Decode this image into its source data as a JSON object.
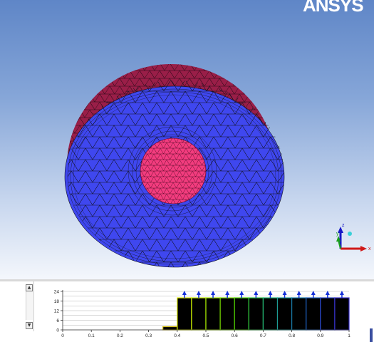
{
  "viewport": {
    "logo_text": "ANSYS",
    "triad": {
      "x_label": "x",
      "y_label": "y",
      "z_label": "z"
    },
    "colors": {
      "body_mesh": "#3f47ef",
      "outer_shell": "#9a1e48",
      "inner_sphere": "#f23c7e",
      "mesh_lines": "#111122",
      "x_axis": "#d01818",
      "y_axis": "#1aa01a",
      "z_axis": "#1818c8"
    }
  },
  "histogram": {
    "chart_data": {
      "type": "bar",
      "bin_edges": [
        0.35,
        0.4,
        0.45,
        0.5,
        0.55,
        0.6,
        0.65,
        0.7,
        0.75,
        0.8,
        0.85,
        0.9,
        0.95,
        1.0
      ],
      "values": [
        2,
        20,
        20,
        20,
        20,
        20,
        20,
        20,
        20,
        20,
        20,
        20,
        20
      ],
      "bar_colors": [
        "#c8b000",
        "#e2f000",
        "#c9f000",
        "#a6ec00",
        "#7ee400",
        "#50d800",
        "#2ec846",
        "#22b474",
        "#1d9c96",
        "#1a7fae",
        "#1f60c0",
        "#2a44c8",
        "#3830cc"
      ],
      "xlim": [
        0,
        1
      ],
      "ylim": [
        0,
        24
      ],
      "x_ticks": [
        "0",
        "0.1",
        "0.2",
        "0.3",
        "0.4",
        "0.5",
        "0.6",
        "0.7",
        "0.8",
        "0.9",
        "1"
      ],
      "y_ticks": [
        "0",
        "6",
        "12",
        "18",
        "24"
      ],
      "marker_color": "#1530d8"
    }
  }
}
